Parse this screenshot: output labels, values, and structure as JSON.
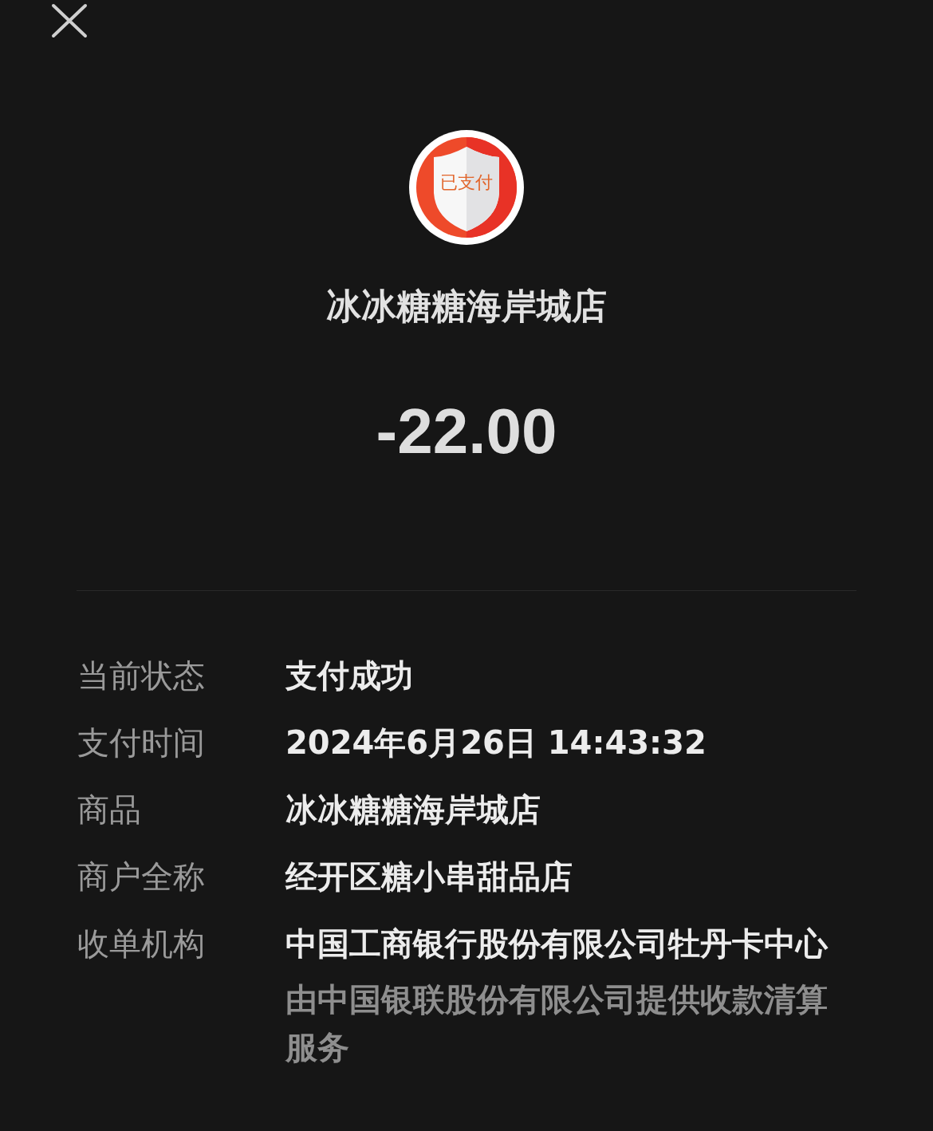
{
  "badge": {
    "label": "已支付"
  },
  "merchant_title": "冰冰糖糖海岸城店",
  "amount": "-22.00",
  "details": [
    {
      "label": "当前状态",
      "value": "支付成功"
    },
    {
      "label": "支付时间",
      "value": "2024年6月26日 14:43:32"
    },
    {
      "label": "商品",
      "value": "冰冰糖糖海岸城店"
    },
    {
      "label": "商户全称",
      "value": "经开区糖小串甜品店"
    },
    {
      "label": "收单机构",
      "value": "中国工商银行股份有限公司牡丹卡中心",
      "note": "由中国银联股份有限公司提供收款清算服务"
    }
  ]
}
